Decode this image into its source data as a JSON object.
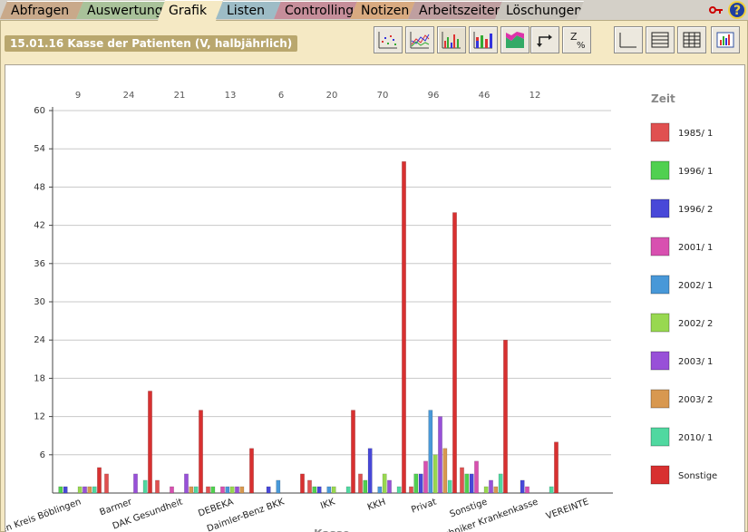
{
  "tabs": [
    {
      "label": "Abfragen",
      "color": "#c9a98a"
    },
    {
      "label": "Auswertung",
      "color": "#a9c29a"
    },
    {
      "label": "Grafik",
      "color": "#f5e9c4"
    },
    {
      "label": "Listen",
      "color": "#9dbcc6"
    },
    {
      "label": "Controlling",
      "color": "#c68e9a"
    },
    {
      "label": "Notizen",
      "color": "#d8aa80"
    },
    {
      "label": "Arbeitszeiten",
      "color": "#bf9fa0"
    },
    {
      "label": "Löschungen",
      "color": "#c8c4bc"
    }
  ],
  "active_tab": "Grafik",
  "header": {
    "title": "15.01.16 Kasse der Patienten (V, halbjährlich)"
  },
  "toolbar": {
    "group1": [
      "scatter-chart-icon",
      "line-chart-icon",
      "bar-chart-icon",
      "stacked-bar-icon",
      "area-chart-icon"
    ],
    "group2": [
      "swap-axes-icon",
      "percent-icon"
    ],
    "group3": [
      "no-table-icon",
      "lines-table-icon",
      "grid-table-icon"
    ],
    "group4": [
      "chart-settings-icon"
    ]
  },
  "chart_data": {
    "type": "bar",
    "xlabel": "Kasse",
    "ylabel": "",
    "ylim": [
      0,
      60
    ],
    "yticks": [
      6,
      12,
      18,
      24,
      30,
      36,
      42,
      48,
      54,
      60
    ],
    "grid": true,
    "legend_title": "Zeit",
    "legend_position": "right",
    "categories": [
      "ur den Kreis Böblingen",
      "Barmer",
      "DAK Gesundheit",
      "DEBEKA",
      "Daimler-Benz BKK",
      "IKK",
      "KKH",
      "Privat",
      "Sonstige",
      "Techniker Krankenkasse",
      "VEREINTE"
    ],
    "totals": [
      "9",
      "24",
      "21",
      "13",
      "6",
      "20",
      "70",
      "96",
      "46",
      "12"
    ],
    "series": [
      {
        "name": "1985/ 1",
        "color": "#e05050",
        "values": [
          0,
          3,
          2,
          1,
          0,
          2,
          3,
          1,
          4,
          0,
          0
        ]
      },
      {
        "name": "1996/ 1",
        "color": "#50d050",
        "values": [
          1,
          0,
          0,
          1,
          0,
          1,
          2,
          3,
          3,
          0,
          0
        ]
      },
      {
        "name": "1996/ 2",
        "color": "#4848d8",
        "values": [
          1,
          0,
          0,
          0,
          1,
          1,
          7,
          3,
          3,
          2,
          0
        ]
      },
      {
        "name": "2001/ 1",
        "color": "#d850b0",
        "values": [
          0,
          0,
          1,
          1,
          0,
          0,
          0,
          5,
          5,
          1,
          0
        ]
      },
      {
        "name": "2002/ 1",
        "color": "#4898d8",
        "values": [
          0,
          0,
          0,
          1,
          2,
          1,
          1,
          13,
          0,
          0,
          0
        ]
      },
      {
        "name": "2002/ 2",
        "color": "#98d850",
        "values": [
          1,
          0,
          0,
          1,
          0,
          1,
          3,
          6,
          1,
          0,
          0
        ]
      },
      {
        "name": "2003/ 1",
        "color": "#9850d8",
        "values": [
          1,
          3,
          3,
          1,
          0,
          0,
          2,
          12,
          2,
          0,
          0
        ]
      },
      {
        "name": "2003/ 2",
        "color": "#d89850",
        "values": [
          1,
          0,
          1,
          1,
          0,
          0,
          0,
          7,
          1,
          0,
          0
        ]
      },
      {
        "name": "2010/ 1",
        "color": "#50d8a0",
        "values": [
          1,
          2,
          1,
          0,
          0,
          1,
          1,
          2,
          3,
          1,
          0
        ]
      },
      {
        "name": "Sonstige",
        "color": "#d83030",
        "values": [
          4,
          16,
          13,
          7,
          3,
          13,
          52,
          44,
          24,
          8,
          0
        ]
      }
    ]
  }
}
